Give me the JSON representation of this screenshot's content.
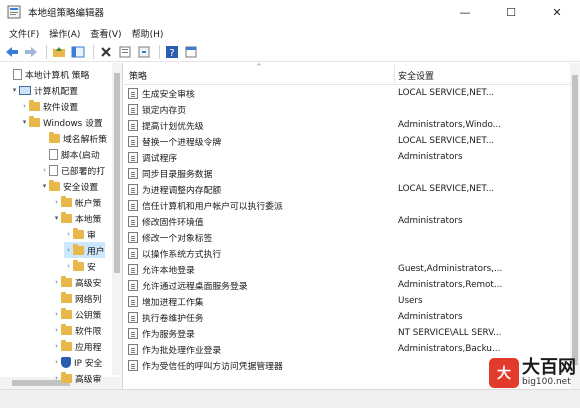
{
  "window": {
    "title": "本地组策略编辑器",
    "minimize": "—",
    "maximize": "☐",
    "close": "✕"
  },
  "menu": [
    "文件(F)",
    "操作(A)",
    "查看(V)",
    "帮助(H)"
  ],
  "toolbar_icons": [
    "back-icon",
    "forward-icon",
    "up-folder-icon",
    "show-hide-tree-icon",
    "delete-icon",
    "properties-icon",
    "export-icon",
    "help-icon",
    "view-icon"
  ],
  "tree": [
    {
      "label": "本地计算机 策略",
      "icon": "doc",
      "arrow": ""
    },
    {
      "label": "计算机配置",
      "icon": "pc",
      "arrow": "▾"
    },
    {
      "label": "软件设置",
      "icon": "folder",
      "arrow": "›"
    },
    {
      "label": "Windows 设置",
      "icon": "folder",
      "arrow": "▾"
    },
    {
      "label": "域名解析策",
      "icon": "folder",
      "arrow": ""
    },
    {
      "label": "脚本(启动",
      "icon": "doc",
      "arrow": ""
    },
    {
      "label": "已部署的打",
      "icon": "doc",
      "arrow": "›"
    },
    {
      "label": "安全设置",
      "icon": "folder",
      "arrow": "▾"
    },
    {
      "label": "帐户策",
      "icon": "folder",
      "arrow": "›"
    },
    {
      "label": "本地策",
      "icon": "folder",
      "arrow": "▾"
    },
    {
      "label": "审",
      "icon": "folder",
      "arrow": "›"
    },
    {
      "label": "用户",
      "icon": "folder",
      "arrow": "›"
    },
    {
      "label": "安",
      "icon": "folder",
      "arrow": "›"
    },
    {
      "label": "高级安",
      "icon": "folder",
      "arrow": "›"
    },
    {
      "label": "网络列",
      "icon": "folder",
      "arrow": ""
    },
    {
      "label": "公钥策",
      "icon": "folder",
      "arrow": "›"
    },
    {
      "label": "软件限",
      "icon": "folder",
      "arrow": "›"
    },
    {
      "label": "应用程",
      "icon": "folder",
      "arrow": "›"
    },
    {
      "label": "IP 安全",
      "icon": "shield",
      "arrow": "›"
    },
    {
      "label": "高级审",
      "icon": "folder",
      "arrow": "›"
    }
  ],
  "columns": {
    "policy": "策略",
    "setting": "安全设置"
  },
  "rows": [
    {
      "name": "生成安全审核",
      "setting": "LOCAL SERVICE,NET..."
    },
    {
      "name": "锁定内存页",
      "setting": ""
    },
    {
      "name": "提高计划优先级",
      "setting": "Administrators,Windo..."
    },
    {
      "name": "替换一个进程级令牌",
      "setting": "LOCAL SERVICE,NET..."
    },
    {
      "name": "调试程序",
      "setting": "Administrators"
    },
    {
      "name": "同步目录服务数据",
      "setting": ""
    },
    {
      "name": "为进程调整内存配额",
      "setting": "LOCAL SERVICE,NET..."
    },
    {
      "name": "信任计算机和用户帐户可以执行委派",
      "setting": ""
    },
    {
      "name": "修改固件环境值",
      "setting": "Administrators"
    },
    {
      "name": "修改一个对象标签",
      "setting": ""
    },
    {
      "name": "以操作系统方式执行",
      "setting": ""
    },
    {
      "name": "允许本地登录",
      "setting": "Guest,Administrators,..."
    },
    {
      "name": "允许通过远程桌面服务登录",
      "setting": "Administrators,Remot..."
    },
    {
      "name": "增加进程工作集",
      "setting": "Users"
    },
    {
      "name": "执行卷维护任务",
      "setting": "Administrators"
    },
    {
      "name": "作为服务登录",
      "setting": "NT SERVICE\\ALL SERV..."
    },
    {
      "name": "作为批处理作业登录",
      "setting": "Administrators,Backu..."
    },
    {
      "name": "作为受信任的呼叫方访问凭据管理器",
      "setting": ""
    }
  ],
  "watermark": {
    "logo": "大",
    "title": "大百网",
    "url": "big100.net"
  }
}
